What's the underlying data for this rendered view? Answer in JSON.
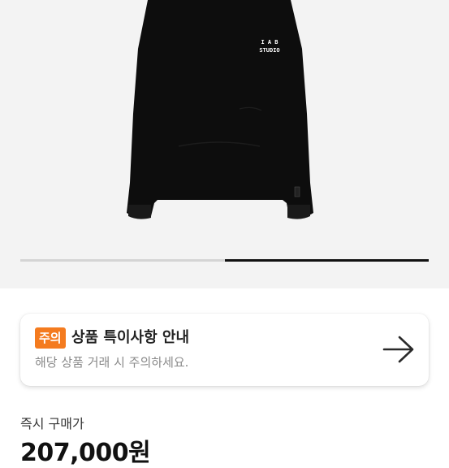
{
  "gallery": {
    "image_alt": "hoodie-photo",
    "print_line1": "I A B",
    "print_line2": "STUDIO",
    "progress": 0.5
  },
  "notice": {
    "badge": "주의",
    "title": "상품 특이사항 안내",
    "subtitle": "해당 상품 거래 시 주의하세요.",
    "icon": "arrow-right-icon"
  },
  "purchase": {
    "label": "즉시 구매가",
    "price": "207,000원"
  },
  "colors": {
    "accent": "#f47b1f",
    "background": "#f3f3f3",
    "text": "#222222"
  }
}
